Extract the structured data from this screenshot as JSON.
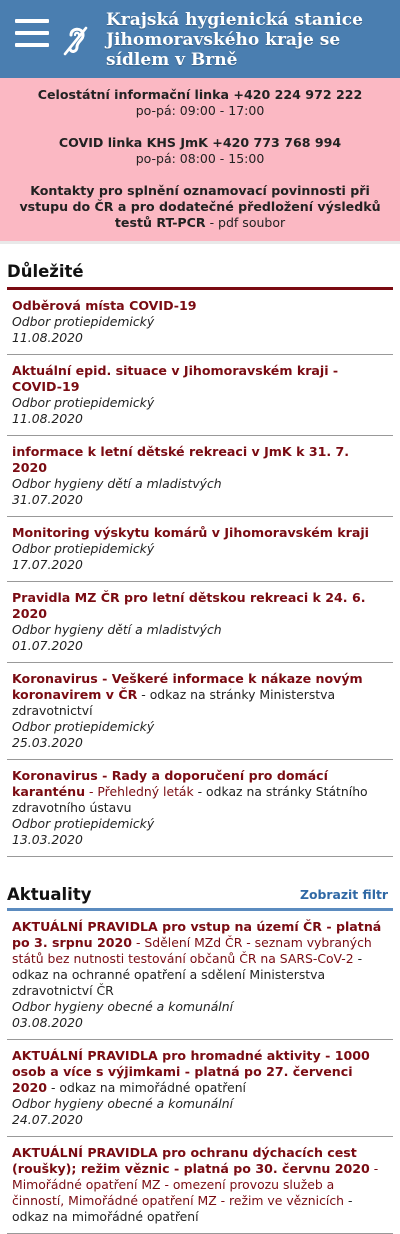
{
  "header": {
    "title": "Krajská hygienická stanice Jihomoravského kraje se sídlem v Brně"
  },
  "contact": {
    "line1": "Celostátní informační linka +420 224 972 222",
    "hours1": "po-pá: 09:00 - 17:00",
    "line2": "COVID linka KHS JmK +420 773 768 994",
    "hours2": "po-pá: 08:00 - 15:00",
    "notice": "Kontakty pro splnění oznamovací povinnosti při vstupu do ČR a pro dodatečné předložení výsledků testů RT-PCR",
    "notice_suffix": "- pdf soubor"
  },
  "dulezite": {
    "heading": "Důležité",
    "items": [
      {
        "title": "Odběrová místa COVID-19",
        "dept": "Odbor protiepidemický",
        "date": "11.08.2020"
      },
      {
        "title": "Aktuální epid. situace v Jihomoravském kraji - COVID-19",
        "dept": "Odbor protiepidemický",
        "date": "11.08.2020"
      },
      {
        "title": "informace k letní dětské rekreaci v JmK k 31. 7. 2020",
        "dept": "Odbor hygieny dětí a mladistvých",
        "date": "31.07.2020"
      },
      {
        "title": "Monitoring výskytu komárů v Jihomoravském kraji",
        "dept": "Odbor protiepidemický",
        "date": "17.07.2020"
      },
      {
        "title": "Pravidla MZ ČR pro letní dětskou rekreaci k 24. 6. 2020",
        "dept": "Odbor hygieny dětí a mladistvých",
        "date": "01.07.2020"
      },
      {
        "title": "Koronavirus - Veškeré informace k nákaze novým koronavirem v ČR",
        "rest": " - odkaz na stránky Ministerstva zdravotnictví",
        "dept": "Odbor protiepidemický",
        "date": "25.03.2020"
      },
      {
        "title": "Koronavirus - Rady a doporučení pro domácí karanténu",
        "link2": " - Přehledný leták",
        "rest": " - odkaz na stránky Státního zdravotního ústavu",
        "dept": "Odbor protiepidemický",
        "date": "13.03.2020"
      }
    ]
  },
  "aktuality": {
    "heading": "Aktuality",
    "filter_label": "Zobrazit filtr",
    "items": [
      {
        "title": "AKTUÁLNÍ PRAVIDLA pro vstup na území ČR - platná po 3. srpnu 2020",
        "link2": " - Sdělení MZd ČR - seznam vybraných států bez nutnosti testování občanů ČR na SARS-CoV-2",
        "rest": " - odkaz na ochranné opatření a sdělení Ministerstva zdravotnictví ČR",
        "dept": "Odbor hygieny obecné a komunální",
        "date": "03.08.2020"
      },
      {
        "title": "AKTUÁLNÍ PRAVIDLA pro hromadné aktivity - 1000 osob a více s výjimkami - platná po 27. červenci 2020",
        "rest": " - odkaz na mimořádné opatření",
        "dept": "Odbor hygieny obecné a komunální",
        "date": "24.07.2020"
      },
      {
        "title": "AKTUÁLNÍ PRAVIDLA pro ochranu dýchacích cest (roušky); režim věznic - platná po 30. červnu 2020",
        "link2": " - Mimořádné opatření MZ - omezení provozu služeb a činností, Mimořádné opatření MZ - režim ve věznicích",
        "rest": " - odkaz na mimořádné opatření",
        "dept": "",
        "date": ""
      }
    ]
  },
  "colors": {
    "header_bg": "#4a7eb0",
    "contact_bg": "#fbb8c3",
    "accent_red": "#7a0b12",
    "accent_blue": "#5b8bbf",
    "link_blue": "#2f68a5"
  }
}
